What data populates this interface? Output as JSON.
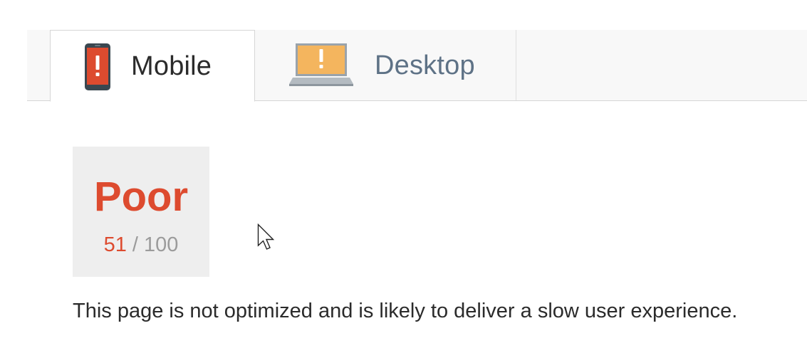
{
  "tabs": {
    "mobile": {
      "label": "Mobile",
      "icon": "mobile-warning-icon",
      "selected": true
    },
    "desktop": {
      "label": "Desktop",
      "icon": "desktop-warning-icon",
      "selected": false
    }
  },
  "score": {
    "rating": "Poor",
    "value": "51",
    "separator": " / ",
    "max": "100",
    "color": "#dd4b2f"
  },
  "summary": {
    "text": "This page is not optimized and is likely to deliver a slow user experience."
  },
  "colors": {
    "poor": "#dd4b2f",
    "desktop_warning": "#f4b55e",
    "desktop_tab_text": "#5e7286"
  }
}
